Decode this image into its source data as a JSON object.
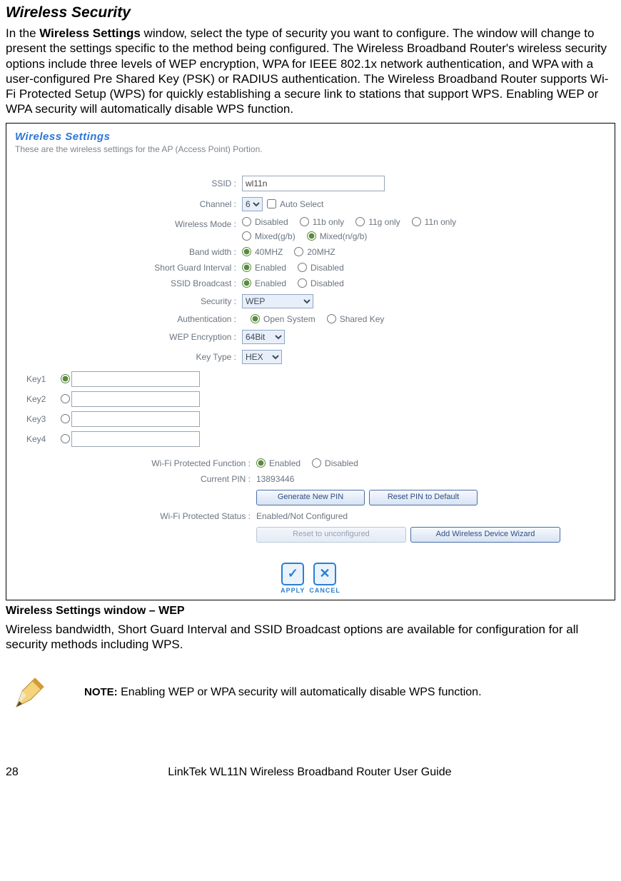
{
  "heading": "Wireless Security",
  "intro_before": "In the ",
  "intro_bold": "Wireless Settings",
  "intro_after": " window, select the type of security you want to configure. The window will change to present the settings specific to the method being configured. The Wireless Broadband Router's wireless security options include three levels of WEP encryption, WPA for IEEE 802.1x network authentication, and WPA with a user-configured Pre Shared Key (PSK) or RADIUS authentication. The Wireless Broadband Router supports Wi-Fi Protected Setup (WPS) for quickly establishing a secure link to stations that support WPS. Enabling WEP or WPA security will automatically disable WPS function.",
  "panel": {
    "title": "Wireless Settings",
    "subtitle": "These are the wireless settings for the AP (Access Point) Portion.",
    "ssid_label": "SSID :",
    "ssid_value": "wl11n",
    "channel_label": "Channel :",
    "channel_value": "6",
    "auto_select": "Auto Select",
    "mode_label": "Wireless Mode :",
    "mode_opts": [
      "Disabled",
      "11b only",
      "11g only",
      "11n only",
      "Mixed(g/b)",
      "Mixed(n/g/b)"
    ],
    "bw_label": "Band width :",
    "bw_opts": [
      "40MHZ",
      "20MHZ"
    ],
    "sgi_label": "Short Guard Interval :",
    "sgi_opts": [
      "Enabled",
      "Disabled"
    ],
    "broadcast_label": "SSID Broadcast :",
    "broadcast_opts": [
      "Enabled",
      "Disabled"
    ],
    "security_label": "Security :",
    "security_value": "WEP",
    "auth_label": "Authentication :",
    "auth_opts": [
      "Open System",
      "Shared Key"
    ],
    "wepenc_label": "WEP Encryption :",
    "wepenc_value": "64Bit",
    "keytype_label": "Key Type :",
    "keytype_value": "HEX",
    "keys": [
      "Key1",
      "Key2",
      "Key3",
      "Key4"
    ],
    "wifipf_label": "Wi-Fi Protected Function :",
    "wifipf_opts": [
      "Enabled",
      "Disabled"
    ],
    "pin_label": "Current PIN :",
    "pin_value": "13893446",
    "btn_genpin": "Generate New PIN",
    "btn_resetpin": "Reset PIN to Default",
    "status_label": "Wi-Fi Protected Status :",
    "status_value": "Enabled/Not Configured",
    "btn_unconf": "Reset to unconfigured",
    "btn_wizard": "Add Wireless Device Wizard",
    "apply": "APPLY",
    "cancel": "CANCEL"
  },
  "caption": "Wireless Settings window – WEP",
  "after_caption": "Wireless bandwidth, Short Guard Interval and SSID Broadcast options are available for configuration for all security methods including WPS.",
  "note_label": "NOTE:",
  "note_text": " Enabling WEP or WPA security will automatically disable WPS function.",
  "footer_page": "28",
  "footer_text": "LinkTek WL11N Wireless Broadband Router User Guide"
}
